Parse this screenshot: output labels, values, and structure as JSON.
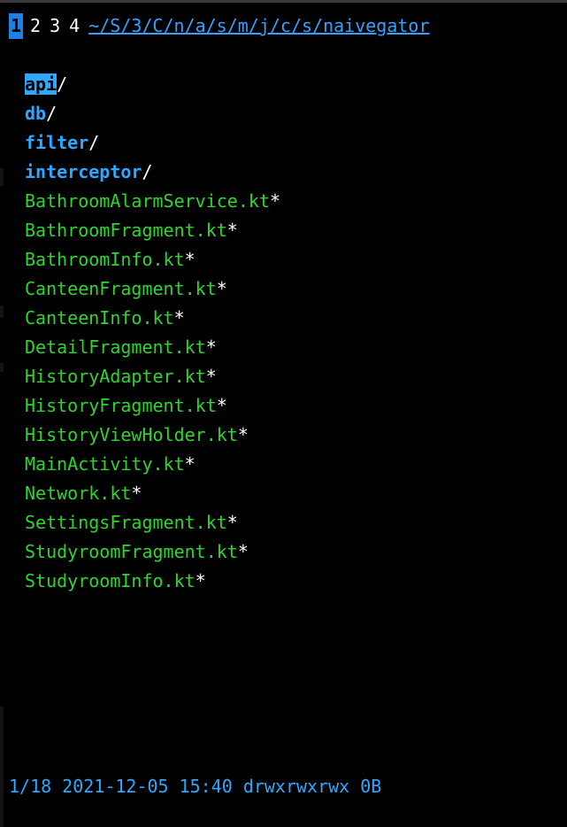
{
  "colors": {
    "background": "#000000",
    "directory": "#2ea7ff",
    "file": "#2ed52e",
    "tab_active": "#1f7fe3",
    "path_link": "#35a0ff"
  },
  "tabs": [
    {
      "label": "1",
      "active": true
    },
    {
      "label": "2",
      "active": false
    },
    {
      "label": "3",
      "active": false
    },
    {
      "label": "4",
      "active": false
    }
  ],
  "path": "~/S/3/C/n/a/s/m/j/c/s/naivegator",
  "directories": [
    {
      "name": "api",
      "suffix": "/",
      "selected": true
    },
    {
      "name": "db",
      "suffix": "/",
      "selected": false
    },
    {
      "name": "filter",
      "suffix": "/",
      "selected": false
    },
    {
      "name": "interceptor",
      "suffix": "/",
      "selected": false
    }
  ],
  "files": [
    {
      "name": "BathroomAlarmService.kt",
      "suffix": "*"
    },
    {
      "name": "BathroomFragment.kt",
      "suffix": "*"
    },
    {
      "name": "BathroomInfo.kt",
      "suffix": "*"
    },
    {
      "name": "CanteenFragment.kt",
      "suffix": "*"
    },
    {
      "name": "CanteenInfo.kt",
      "suffix": "*"
    },
    {
      "name": "DetailFragment.kt",
      "suffix": "*"
    },
    {
      "name": "HistoryAdapter.kt",
      "suffix": "*"
    },
    {
      "name": "HistoryFragment.kt",
      "suffix": "*"
    },
    {
      "name": "HistoryViewHolder.kt",
      "suffix": "*"
    },
    {
      "name": "MainActivity.kt",
      "suffix": "*"
    },
    {
      "name": "Network.kt",
      "suffix": "*"
    },
    {
      "name": "SettingsFragment.kt",
      "suffix": "*"
    },
    {
      "name": "StudyroomFragment.kt",
      "suffix": "*"
    },
    {
      "name": "StudyroomInfo.kt",
      "suffix": "*"
    }
  ],
  "status": {
    "position": "1/18",
    "date": "2021-12-05",
    "time": "15:40",
    "permissions": "drwxrwxrwx",
    "size": "0B"
  }
}
